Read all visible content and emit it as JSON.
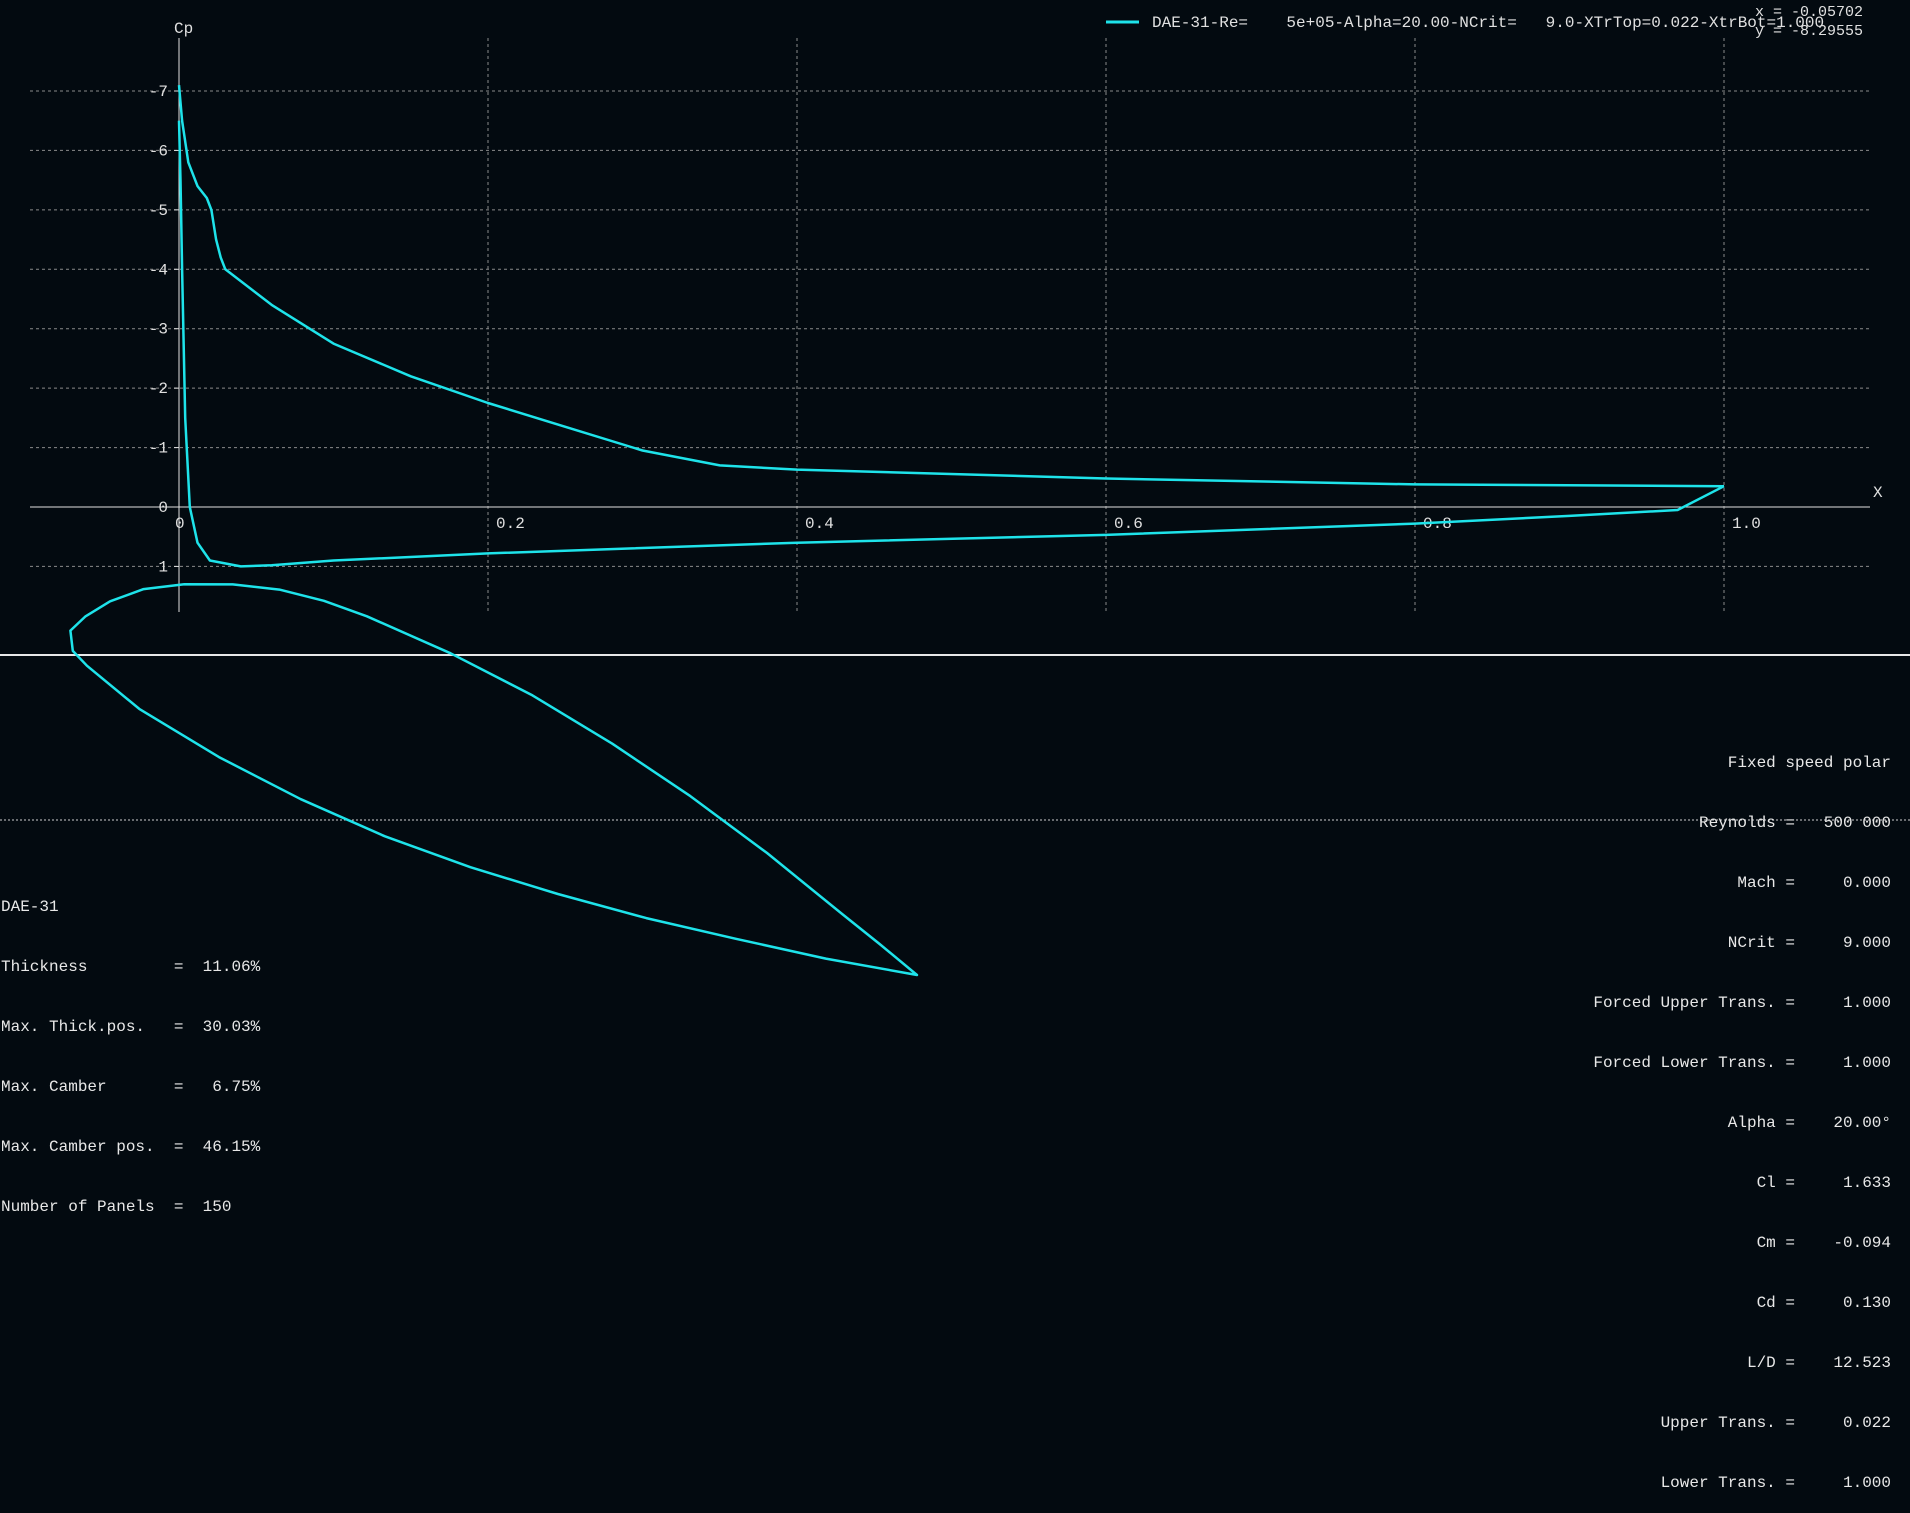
{
  "chart_data": {
    "type": "line",
    "ylabel": "Cp",
    "xlabel": "X",
    "x_ticks": [
      "0",
      "0.2",
      "0.4",
      "0.6",
      "0.8",
      "1.0"
    ],
    "y_ticks": [
      "-7",
      "-6",
      "-5",
      "-4",
      "-3",
      "-2",
      "-1",
      "0",
      "1"
    ],
    "xlim": [
      -0.095,
      1.095
    ],
    "ylim": [
      -7.9,
      1.75
    ],
    "y_inverted": true,
    "grid": true,
    "legend_position": "top-right",
    "cursor_readout": {
      "x": "x = -0.05702",
      "y": "y = -8.29555"
    },
    "series": [
      {
        "name": "DAE-31-Re=    5e+05-Alpha=20.00-NCrit=   9.0-XTrTop=0.022-XtrBot=1.000",
        "color": "#1ee3ea",
        "upper": [
          [
            1.0,
            -0.35
          ],
          [
            0.8,
            -0.38
          ],
          [
            0.6,
            -0.48
          ],
          [
            0.4,
            -0.63
          ],
          [
            0.35,
            -0.7
          ],
          [
            0.3,
            -0.95
          ],
          [
            0.25,
            -1.35
          ],
          [
            0.2,
            -1.75
          ],
          [
            0.15,
            -2.2
          ],
          [
            0.1,
            -2.75
          ],
          [
            0.06,
            -3.4
          ],
          [
            0.03,
            -4.0
          ],
          [
            0.027,
            -4.2
          ],
          [
            0.024,
            -4.5
          ],
          [
            0.021,
            -5.0
          ],
          [
            0.018,
            -5.2
          ],
          [
            0.012,
            -5.4
          ],
          [
            0.006,
            -5.8
          ],
          [
            0.002,
            -6.5
          ],
          [
            0.0,
            -7.1
          ]
        ],
        "lower": [
          [
            0.0,
            -6.5
          ],
          [
            0.001,
            -5.5
          ],
          [
            0.002,
            -4.0
          ],
          [
            0.004,
            -1.5
          ],
          [
            0.007,
            0.0
          ],
          [
            0.012,
            0.6
          ],
          [
            0.02,
            0.9
          ],
          [
            0.04,
            1.0
          ],
          [
            0.06,
            0.98
          ],
          [
            0.1,
            0.9
          ],
          [
            0.2,
            0.78
          ],
          [
            0.4,
            0.6
          ],
          [
            0.6,
            0.47
          ],
          [
            0.8,
            0.28
          ],
          [
            0.9,
            0.15
          ],
          [
            0.97,
            0.05
          ],
          [
            1.0,
            -0.35
          ]
        ]
      }
    ]
  },
  "airfoil": {
    "outline": [
      [
        1.0,
        0.0
      ],
      [
        0.95,
        0.018
      ],
      [
        0.9,
        0.035
      ],
      [
        0.8,
        0.07
      ],
      [
        0.7,
        0.1
      ],
      [
        0.6,
        0.125
      ],
      [
        0.5,
        0.145
      ],
      [
        0.4,
        0.158
      ],
      [
        0.3,
        0.165
      ],
      [
        0.25,
        0.165
      ],
      [
        0.2,
        0.16
      ],
      [
        0.15,
        0.148
      ],
      [
        0.1,
        0.13
      ],
      [
        0.06,
        0.11
      ],
      [
        0.03,
        0.085
      ],
      [
        0.01,
        0.06
      ],
      [
        0.0,
        0.04
      ],
      [
        0.01,
        0.02
      ],
      [
        0.03,
        0.01
      ],
      [
        0.1,
        -0.015
      ],
      [
        0.2,
        -0.035
      ],
      [
        0.3,
        -0.048
      ],
      [
        0.4,
        -0.055
      ],
      [
        0.5,
        -0.055
      ],
      [
        0.6,
        -0.05
      ],
      [
        0.7,
        -0.042
      ],
      [
        0.8,
        -0.03
      ],
      [
        0.9,
        -0.017
      ],
      [
        1.0,
        0.0
      ]
    ],
    "color": "#1ee3ea"
  },
  "airfoil_info": {
    "name": "DAE-31",
    "rows": [
      "Thickness         =  11.06%",
      "Max. Thick.pos.   =  30.03%",
      "Max. Camber       =   6.75%",
      "Max. Camber pos.  =  46.15%",
      "Number of Panels  =  150"
    ]
  },
  "polar_info": {
    "rows": [
      "Fixed speed polar",
      "Reynolds =   500 000",
      "Mach =     0.000",
      "NCrit =     9.000",
      "Forced Upper Trans. =     1.000",
      "Forced Lower Trans. =     1.000",
      "Alpha =    20.00°",
      "Cl =     1.633",
      "Cm =    -0.094",
      "Cd =     0.130",
      "L/D =    12.523",
      "Upper Trans. =     0.022",
      "Lower Trans. =     1.000"
    ]
  },
  "colors": {
    "background": "#030a10",
    "curve": "#1ee3ea",
    "axis": "#e0e0e0",
    "grid": "#8a8a8a"
  }
}
